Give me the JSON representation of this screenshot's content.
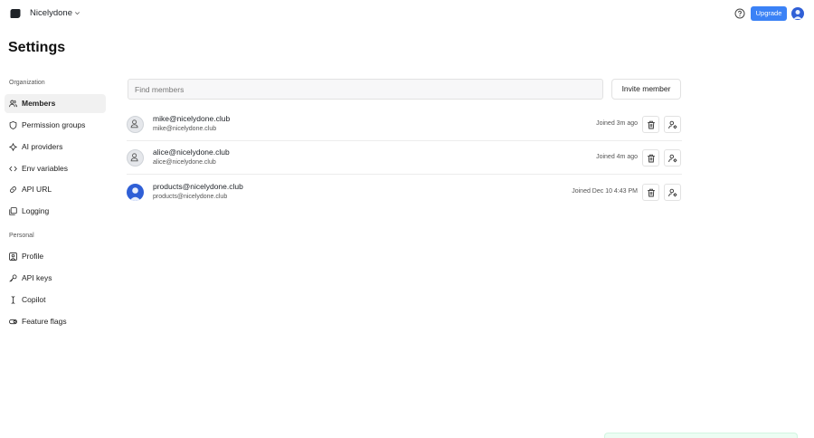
{
  "topbar": {
    "org_name": "Nicelydone",
    "upgrade_label": "Upgrade"
  },
  "page": {
    "title": "Settings"
  },
  "sidebar": {
    "sections": [
      {
        "label": "Organization",
        "items": [
          {
            "label": "Members",
            "icon": "users-icon",
            "active": true
          },
          {
            "label": "Permission groups",
            "icon": "shield-icon"
          },
          {
            "label": "AI providers",
            "icon": "sparkle-icon"
          },
          {
            "label": "Env variables",
            "icon": "code-icon"
          },
          {
            "label": "API URL",
            "icon": "link-icon"
          },
          {
            "label": "Logging",
            "icon": "logging-icon"
          }
        ]
      },
      {
        "label": "Personal",
        "items": [
          {
            "label": "Profile",
            "icon": "profile-icon"
          },
          {
            "label": "API keys",
            "icon": "key-icon"
          },
          {
            "label": "Copilot",
            "icon": "text-cursor-icon"
          },
          {
            "label": "Feature flags",
            "icon": "toggle-icon"
          }
        ]
      }
    ]
  },
  "members": {
    "search_placeholder": "Find members",
    "invite_label": "Invite member",
    "rows": [
      {
        "name": "mike@nicelydone.club",
        "email": "mike@nicelydone.club",
        "joined": "Joined 3m ago",
        "avatar": "default"
      },
      {
        "name": "alice@nicelydone.club",
        "email": "alice@nicelydone.club",
        "joined": "Joined 4m ago",
        "avatar": "default"
      },
      {
        "name": "products@nicelydone.club",
        "email": "products@nicelydone.club",
        "joined": "Joined Dec 10 4:43 PM",
        "avatar": "photo"
      }
    ]
  },
  "colors": {
    "accent": "#3b82f6",
    "active_nav_bg": "#f1f1f1",
    "photo_avatar": "#2f5fd6"
  }
}
